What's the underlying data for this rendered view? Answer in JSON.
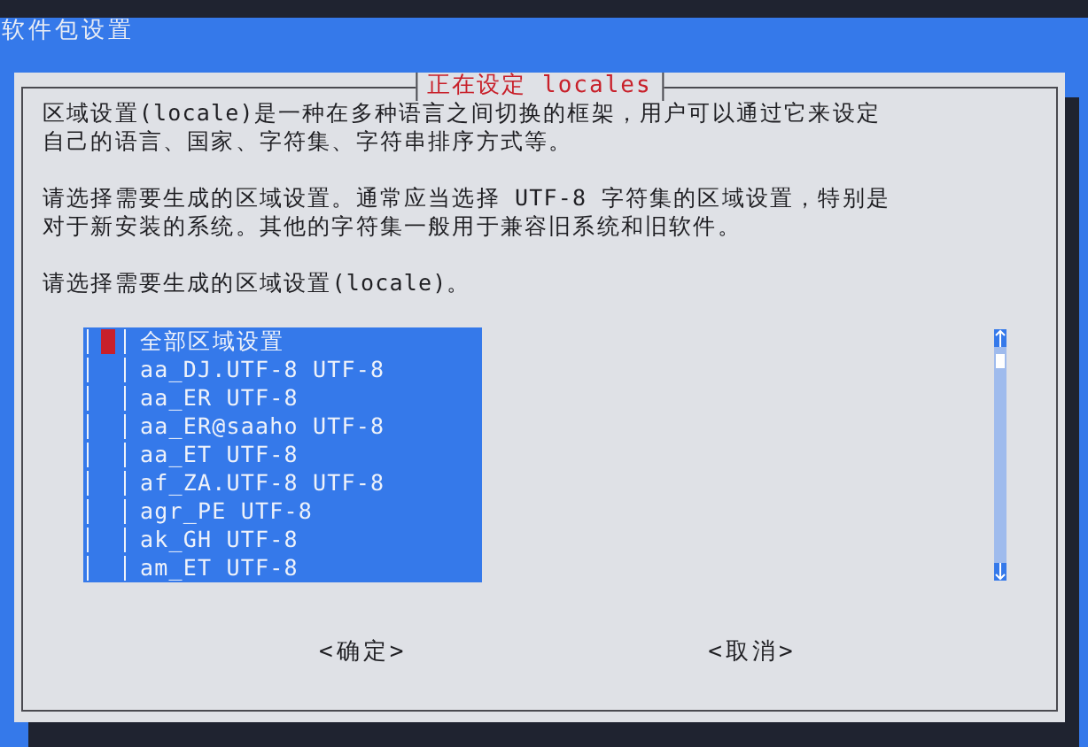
{
  "window": {
    "title": "软件包设置"
  },
  "dialog": {
    "title": "正在设定 locales",
    "paragraphs": [
      [
        "区域设置(locale)是一种在多种语言之间切换的框架，用户可以通过它来设定",
        "自己的语言、国家、字符集、字符串排序方式等。"
      ],
      [
        "请选择需要生成的区域设置。通常应当选择 UTF-8 字符集的区域设置，特别是",
        "对于新安装的系统。其他的字符集一般用于兼容旧系统和旧软件。"
      ],
      [
        "请选择需要生成的区域设置(locale)。"
      ]
    ],
    "items": [
      {
        "label": "全部区域设置",
        "checked": false,
        "focused": true
      },
      {
        "label": "aa_DJ.UTF-8 UTF-8",
        "checked": false,
        "focused": false
      },
      {
        "label": "aa_ER UTF-8",
        "checked": false,
        "focused": false
      },
      {
        "label": "aa_ER@saaho UTF-8",
        "checked": false,
        "focused": false
      },
      {
        "label": "aa_ET UTF-8",
        "checked": false,
        "focused": false
      },
      {
        "label": "af_ZA.UTF-8 UTF-8",
        "checked": false,
        "focused": false
      },
      {
        "label": "agr_PE UTF-8",
        "checked": false,
        "focused": false
      },
      {
        "label": "ak_GH UTF-8",
        "checked": false,
        "focused": false
      },
      {
        "label": "am_ET UTF-8",
        "checked": false,
        "focused": false
      }
    ],
    "buttons": [
      {
        "label": "<确定>",
        "selected": false
      },
      {
        "label": "<取消>",
        "selected": false
      }
    ]
  }
}
